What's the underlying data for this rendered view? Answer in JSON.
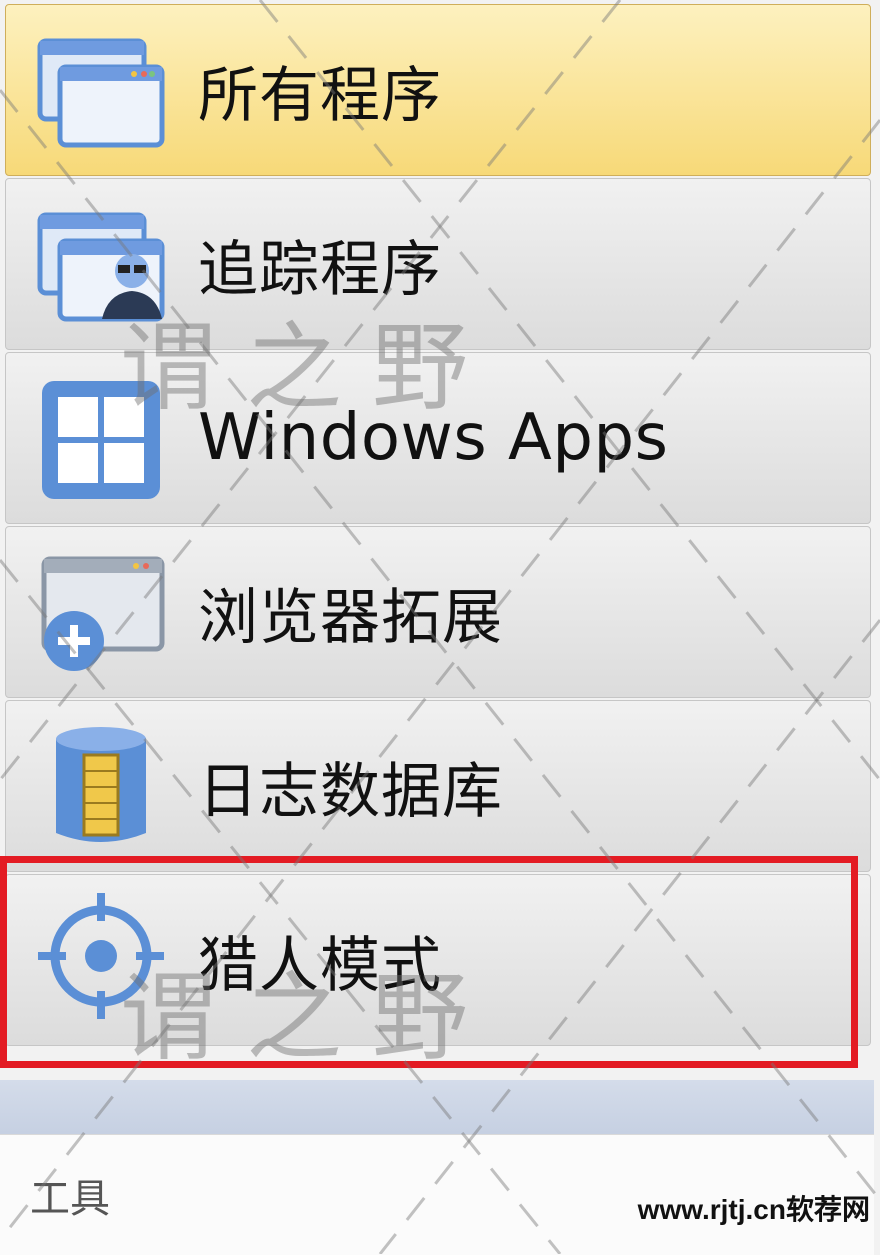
{
  "menu": {
    "items": [
      {
        "label": "所有程序",
        "icon": "all-programs-icon"
      },
      {
        "label": "追踪程序",
        "icon": "trace-program-icon"
      },
      {
        "label": "Windows Apps",
        "icon": "windows-logo-icon"
      },
      {
        "label": "浏览器拓展",
        "icon": "browser-extension-icon"
      },
      {
        "label": "日志数据库",
        "icon": "log-database-icon"
      },
      {
        "label": "猎人模式",
        "icon": "crosshair-icon"
      }
    ],
    "active_index": 0,
    "highlighted_index": 5
  },
  "tools": {
    "label": "工具"
  },
  "watermark": {
    "text": "谓之野",
    "site": "www.rjtj.cn软荐网"
  },
  "colors": {
    "highlight": "#e31b23",
    "active_bg": "#f7d978",
    "icon_blue": "#5b8fd6"
  }
}
